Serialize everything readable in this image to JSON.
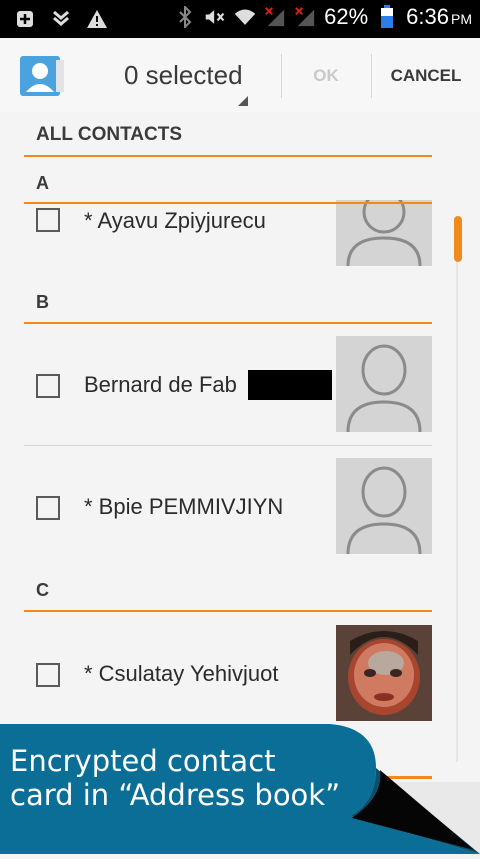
{
  "status_bar": {
    "battery_percent": "62%",
    "time": "6:36",
    "ampm": "PM",
    "icons": [
      "add-box-icon",
      "download-icon",
      "warning-icon",
      "bluetooth-icon",
      "mute-icon",
      "wifi-icon",
      "signal-off-icon",
      "signal-off-icon",
      "battery-icon"
    ]
  },
  "action_bar": {
    "selected_label": "0 selected",
    "ok_label": "OK",
    "cancel_label": "CANCEL"
  },
  "list": {
    "header": "ALL CONTACTS",
    "sections": [
      {
        "letter": "A",
        "contacts": [
          {
            "name": "* Ayavu Zpiyjurecu",
            "avatar": "placeholder"
          }
        ]
      },
      {
        "letter": "B",
        "contacts": [
          {
            "name": "Bernard de Fab",
            "avatar": "placeholder",
            "redacted": true
          },
          {
            "name": "* Bpie PEMMIVJIYN",
            "avatar": "placeholder"
          }
        ]
      },
      {
        "letter": "C",
        "contacts": [
          {
            "name": "* Csulatay Yehivjuot",
            "avatar": "photo"
          }
        ]
      }
    ]
  },
  "banner": {
    "line1": "Encrypted contact",
    "line2": "card in “Address book”",
    "color": "#0b6e96"
  },
  "colors": {
    "accent": "#f08a1c",
    "statusbar": "#000000"
  }
}
